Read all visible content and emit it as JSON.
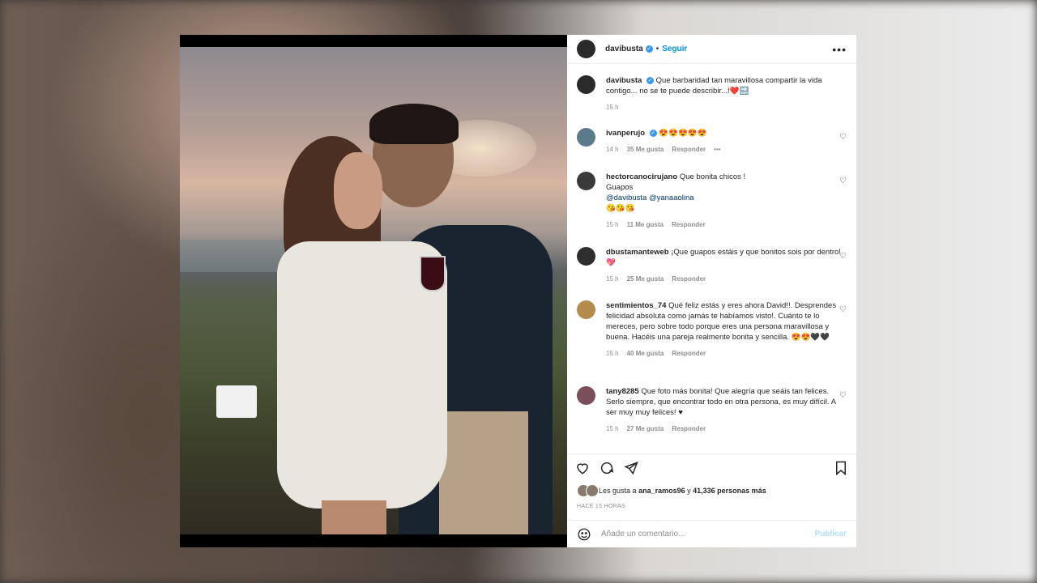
{
  "post": {
    "username": "davibusta",
    "follow_label": "Seguir",
    "dot": "•",
    "more_icon": "more-options-icon"
  },
  "caption": {
    "username": "davibusta",
    "text": "Que barbaridad tan maravillosa compartir la vida contigo... no se te puede describir...!",
    "emoji": "❤️🔜",
    "time": "15 h"
  },
  "comments": [
    {
      "username": "ivanperujo",
      "verified": true,
      "text": "😍😍😍😍😍",
      "time": "14 h",
      "likes": "35 Me gusta",
      "reply": "Responder",
      "more": "•••"
    },
    {
      "username": "hectorcanocirujano",
      "text": "Que bonita chicos !",
      "line2": "Guapos",
      "mention1": "@davibusta",
      "mention2": "@yanaaolina",
      "line4": "😘😘😘",
      "time": "15 h",
      "likes": "11 Me gusta",
      "reply": "Responder"
    },
    {
      "username": "dbustamanteweb",
      "text": "¡Que guapos estáis y que bonitos sois por dentro!",
      "emoji": "💖",
      "time": "15 h",
      "likes": "25 Me gusta",
      "reply": "Responder"
    },
    {
      "username": "sentimientos_74",
      "text": "Qué feliz estás y eres ahora David!!. Desprendes felicidad absoluta como jamás te habíamos visto!. Cuánto te lo mereces, pero sobre todo porque eres una persona maravillosa y buena. Hacéis una pareja realmente bonita y sencilla.",
      "emoji": "😍😍🖤🖤",
      "time": "15 h",
      "likes": "40 Me gusta",
      "reply": "Responder"
    },
    {
      "username": "tany8285",
      "text": "Que foto más bonita! Que alegría que seáis tan felices. Serlo siempre, que encontrar todo en otra persona, es muy difícil. A ser muy muy felices!",
      "emoji": "♥",
      "time": "15 h",
      "likes": "27 Me gusta",
      "reply": "Responder"
    }
  ],
  "likes": {
    "prefix": "Les gusta a",
    "user": "ana_ramos96",
    "and": "y",
    "count": "41,336 personas más"
  },
  "timestamp": "HACE 15 HORAS",
  "add_comment": {
    "placeholder": "Añade un comentario...",
    "publish": "Publicar"
  },
  "colors": {
    "accent": "#0095f6",
    "publish_disabled": "#b2dffc",
    "verified": "#3897f0"
  }
}
